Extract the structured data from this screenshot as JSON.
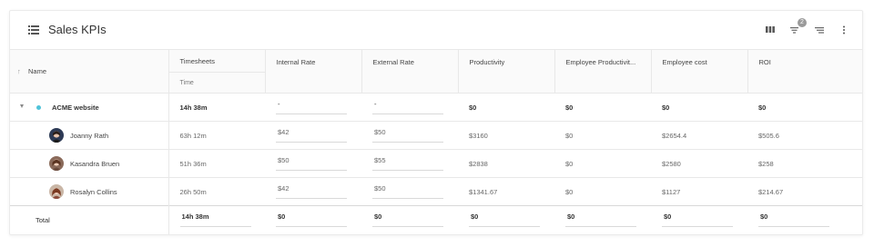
{
  "header": {
    "title": "Sales KPIs",
    "filter_count": "2",
    "icons": [
      "list-icon",
      "columns-icon",
      "filter-icon",
      "sort-icon",
      "more-icon"
    ]
  },
  "columns": {
    "name": "Name",
    "timesheets": "Timesheets",
    "timesheets_sub": "Time",
    "internal_rate": "Internal Rate",
    "external_rate": "External Rate",
    "productivity": "Productivity",
    "employee_productivity": "Employee Productivit...",
    "employee_cost": "Employee cost",
    "roi": "ROI"
  },
  "group": {
    "name": "ACME website",
    "dot_color": "#4fc3d9",
    "time": "14h 38m",
    "internal_rate": "-",
    "external_rate": "-",
    "productivity": "$0",
    "employee_productivity": "$0",
    "employee_cost": "$0",
    "roi": "$0"
  },
  "members": [
    {
      "name": "Joanny Rath",
      "time": "63h 12m",
      "internal_rate": "$42",
      "external_rate": "$50",
      "productivity": "$3160",
      "employee_productivity": "$0",
      "employee_cost": "$2654.4",
      "roi": "$505.6"
    },
    {
      "name": "Kasandra Bruen",
      "time": "51h 36m",
      "internal_rate": "$50",
      "external_rate": "$55",
      "productivity": "$2838",
      "employee_productivity": "$0",
      "employee_cost": "$2580",
      "roi": "$258"
    },
    {
      "name": "Rosalyn Collins",
      "time": "26h 50m",
      "internal_rate": "$42",
      "external_rate": "$50",
      "productivity": "$1341.67",
      "employee_productivity": "$0",
      "employee_cost": "$1127",
      "roi": "$214.67"
    }
  ],
  "total": {
    "label": "Total",
    "time": "14h 38m",
    "internal_rate": "$0",
    "external_rate": "$0",
    "productivity": "$0",
    "employee_productivity": "$0",
    "employee_cost": "$0",
    "roi": "$0"
  }
}
